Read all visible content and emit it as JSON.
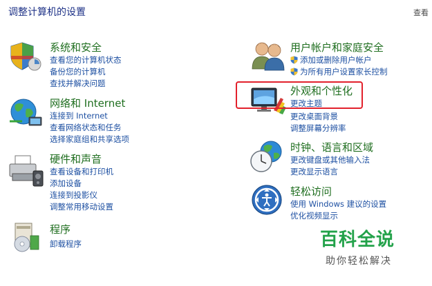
{
  "header": {
    "title": "调整计算机的设置",
    "view_by": "查看"
  },
  "left": [
    {
      "title": "系统和安全",
      "links": [
        "查看您的计算机状态",
        "备份您的计算机",
        "查找并解决问题"
      ]
    },
    {
      "title": "网络和 Internet",
      "links": [
        "连接到 Internet",
        "查看网络状态和任务",
        "选择家庭组和共享选项"
      ]
    },
    {
      "title": "硬件和声音",
      "links": [
        "查看设备和打印机",
        "添加设备",
        "连接到投影仪",
        "调整常用移动设置"
      ]
    },
    {
      "title": "程序",
      "links": [
        "卸载程序"
      ]
    }
  ],
  "right": [
    {
      "title": "用户帐户和家庭安全",
      "links": [
        "添加或删除用户帐户",
        "为所有用户设置家长控制"
      ]
    },
    {
      "title": "外观和个性化",
      "links": [
        "更改主题",
        "更改桌面背景",
        "调整屏幕分辨率"
      ]
    },
    {
      "title": "时钟、语言和区域",
      "links": [
        "更改键盘或其他输入法",
        "更改显示语言"
      ]
    },
    {
      "title": "轻松访问",
      "links": [
        "使用 Windows 建议的设置",
        "优化视频显示"
      ]
    }
  ],
  "watermark": {
    "title": "百科全说",
    "subtitle": "助你轻松解决"
  },
  "colors": {
    "category_title": "#1f6e1f",
    "link": "#1e50a2",
    "highlight": "#e2202b"
  }
}
